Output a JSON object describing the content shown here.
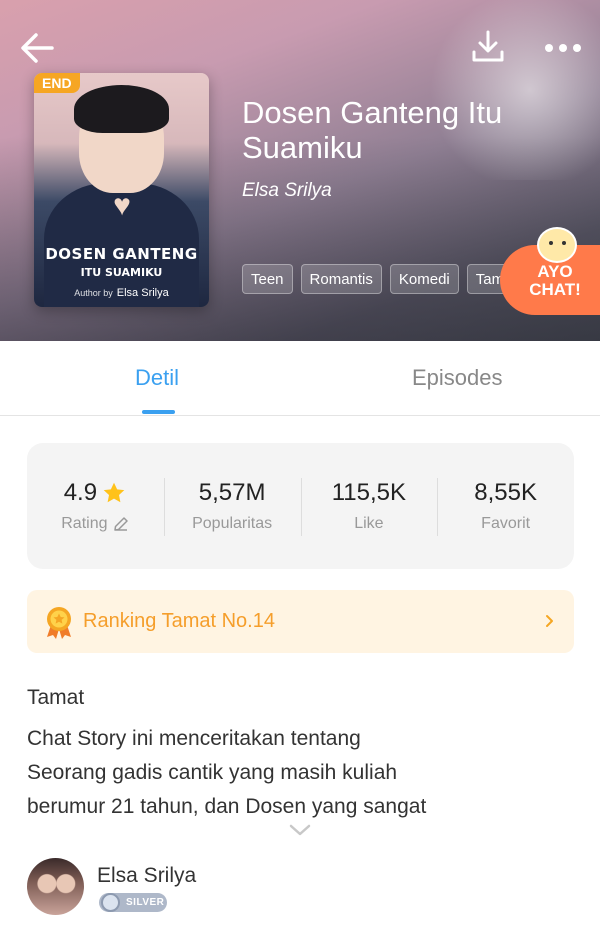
{
  "hero": {
    "end_badge": "END",
    "title": "Dosen Ganteng Itu Suamiku",
    "author": "Elsa Srilya",
    "tags": [
      "Teen",
      "Romantis",
      "Komedi",
      "Tam"
    ],
    "cover": {
      "title_line1": "DOSEN GANTENG",
      "title_line2": "ITU SUAMIKU",
      "author_prefix": "Author by",
      "author": "Elsa Srilya"
    },
    "ayo_chat_line1": "AYO",
    "ayo_chat_line2": "CHAT!",
    "icons": {
      "back": "back-arrow-icon",
      "download": "download-icon",
      "more": "more-dots-icon"
    }
  },
  "tabs": {
    "detail": "Detil",
    "episodes": "Episodes",
    "active": "Detil"
  },
  "stats": {
    "rating": {
      "value": "4.9",
      "label": "Rating"
    },
    "popularity": {
      "value": "5,57M",
      "label": "Popularitas"
    },
    "like": {
      "value": "115,5K",
      "label": "Like"
    },
    "favorite": {
      "value": "8,55K",
      "label": "Favorit"
    }
  },
  "ranking": {
    "text": "Ranking Tamat No.14"
  },
  "description": {
    "status": "Tamat",
    "lines": [
      "Chat Story ini menceritakan tentang",
      "Seorang gadis cantik yang masih kuliah",
      "berumur 21 tahun, dan Dosen yang sangat"
    ]
  },
  "author_section": {
    "name": "Elsa Srilya",
    "badge": "SILVER"
  },
  "colors": {
    "accent": "#3aa0f0",
    "ranking_text": "#f59e2b",
    "ranking_bg": "#fff4e2",
    "ayo_chat": "#ff7a4a",
    "end_badge": "#f6a623"
  }
}
